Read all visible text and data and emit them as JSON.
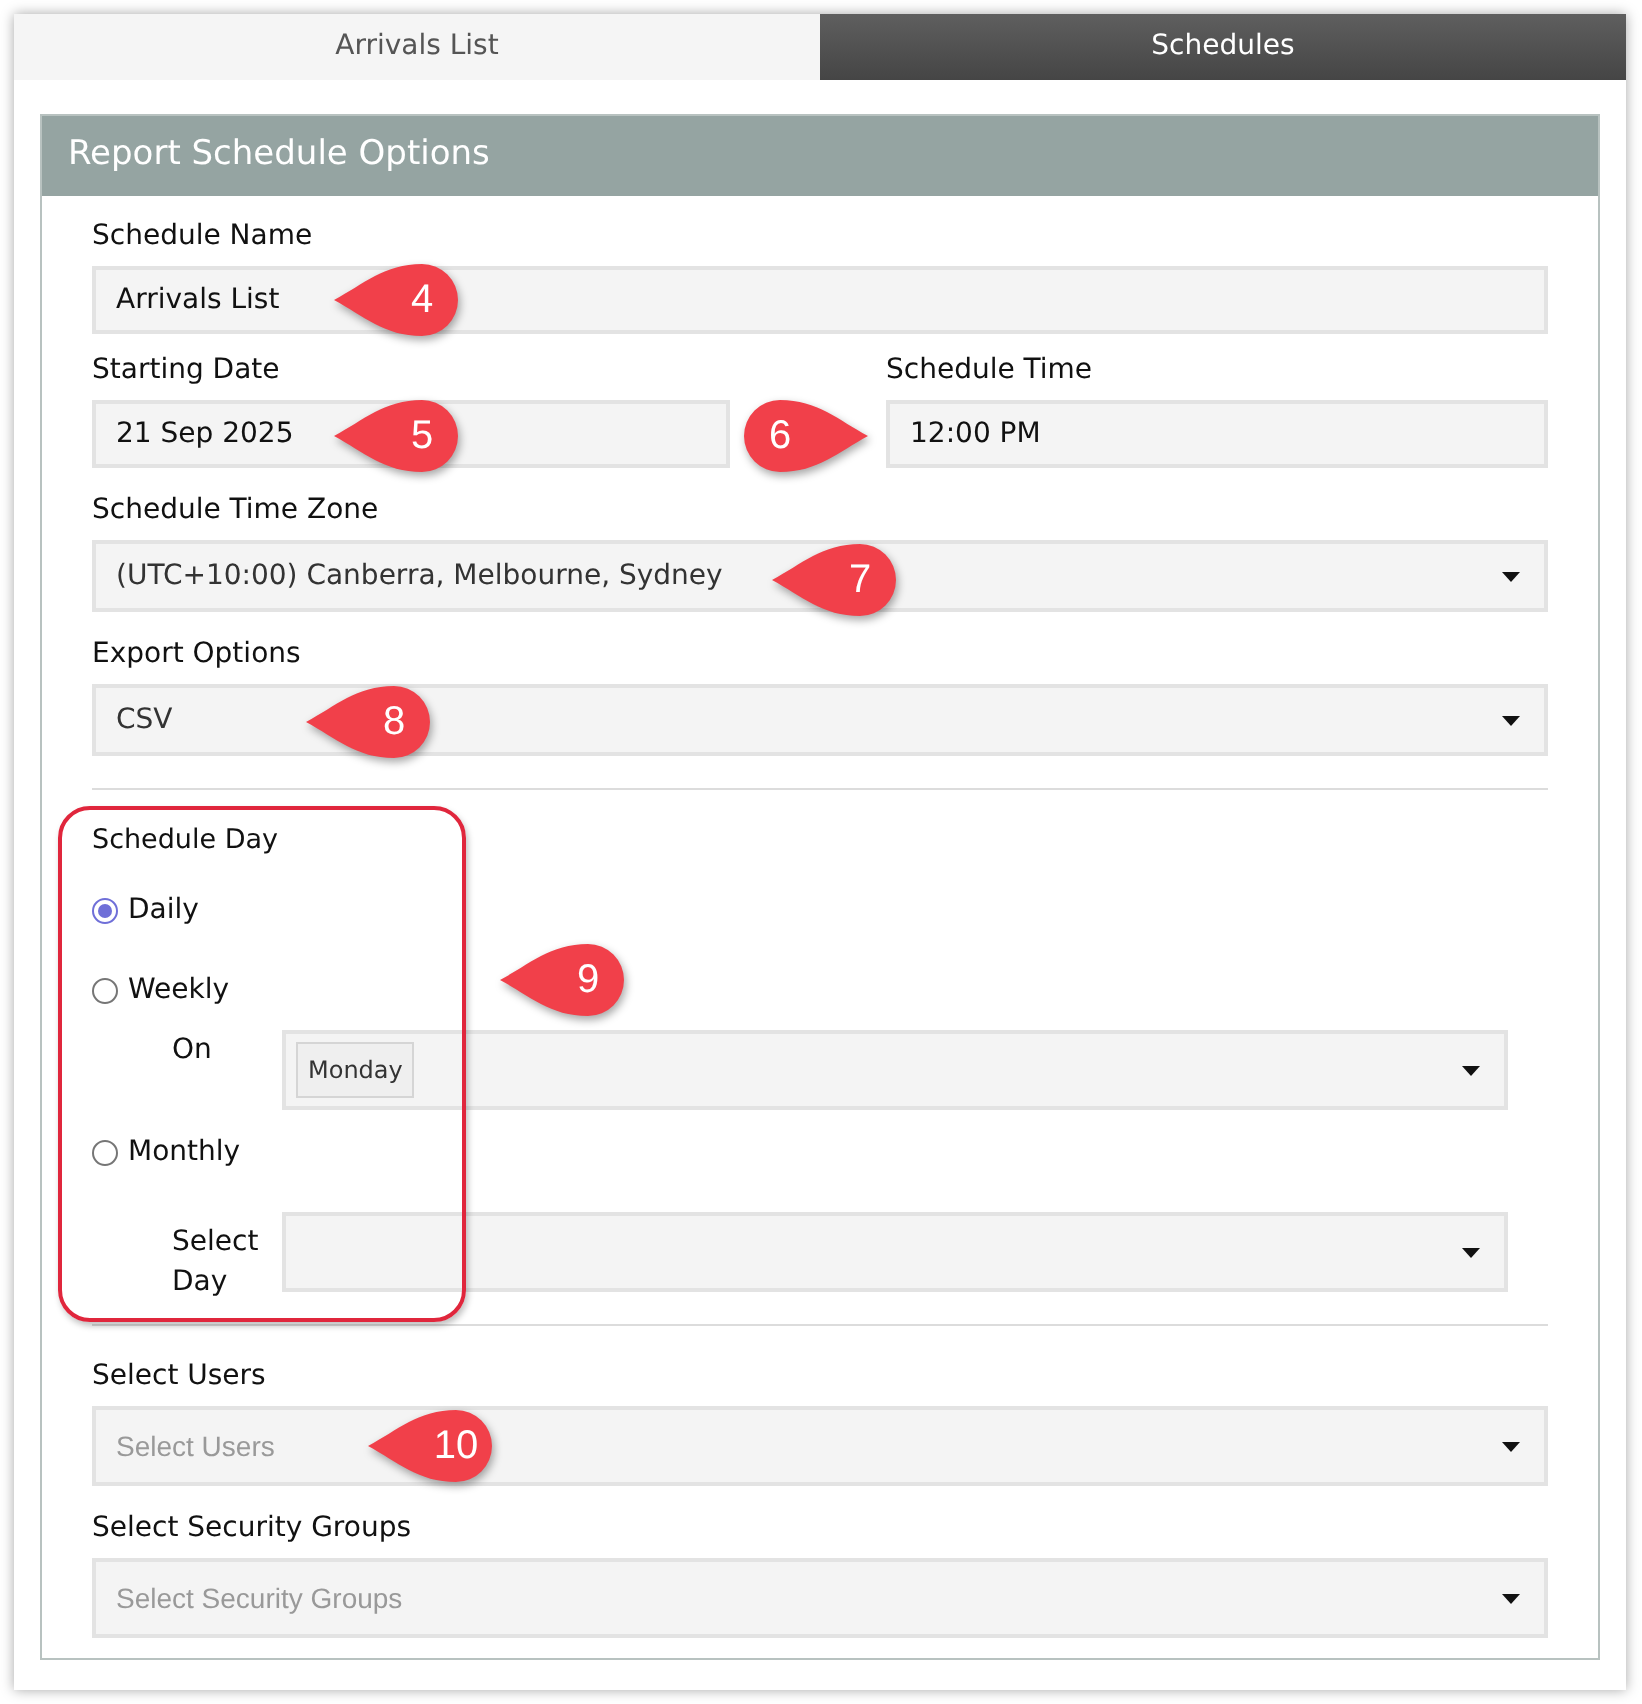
{
  "tabs": [
    {
      "label": "Arrivals List",
      "selected": false
    },
    {
      "label": "Schedules",
      "selected": true
    }
  ],
  "panel": {
    "title": "Report Schedule Options"
  },
  "schedule_name": {
    "label": "Schedule Name",
    "value": "Arrivals List",
    "callout": {
      "label": "4",
      "points_right": false
    }
  },
  "starting_date": {
    "label": "Starting Date",
    "value": "21 Sep 2025",
    "callout": {
      "label": "5",
      "points_right": false
    }
  },
  "schedule_time": {
    "label": "Schedule Time",
    "value": "12:00 PM",
    "callout": {
      "label": "6",
      "points_right": true
    }
  },
  "time_zone": {
    "label": "Schedule Time Zone",
    "value": "(UTC+10:00) Canberra, Melbourne, Sydney",
    "callout": {
      "label": "7",
      "points_right": false
    }
  },
  "export_options": {
    "label": "Export Options",
    "value": "CSV",
    "callout": {
      "label": "8",
      "points_right": false
    }
  },
  "schedule_day": {
    "label": "Schedule Day",
    "highlighted": true,
    "callout": {
      "label": "9",
      "points_right": false
    },
    "options": [
      {
        "label": "Daily",
        "selected": true
      },
      {
        "label": "Weekly",
        "selected": false,
        "sub": {
          "label": "On",
          "tags": [
            "Monday"
          ]
        }
      },
      {
        "label": "Monthly",
        "selected": false,
        "sub": {
          "label": "Select Day"
        }
      }
    ]
  },
  "select_users": {
    "label": "Select Users",
    "placeholder": "Select Users",
    "callout": {
      "label": "10",
      "points_right": false
    }
  },
  "security_groups": {
    "label": "Select Security Groups",
    "placeholder": "Select Security Groups"
  }
}
